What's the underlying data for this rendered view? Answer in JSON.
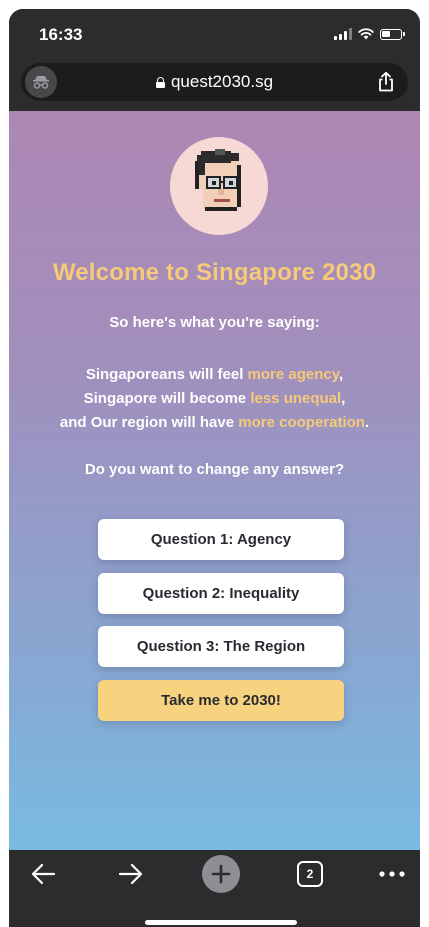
{
  "status_bar": {
    "time": "16:33",
    "battery_level": 0.45
  },
  "browser": {
    "url": "quest2030.sg",
    "incognito_icon": "incognito-icon",
    "share_icon": "share-icon",
    "open_tabs": "2"
  },
  "page": {
    "title": "Welcome to Singapore 2030",
    "intro": "So here's what you're saying:",
    "summary": {
      "line1_prefix": "Singaporeans will feel ",
      "line1_value": "more agency",
      "line1_suffix": ",",
      "line2_prefix": "Singapore will become ",
      "line2_value": "less unequal",
      "line2_suffix": ",",
      "line3_prefix": "and Our region will have ",
      "line3_value": "more cooperation",
      "line3_suffix": "."
    },
    "question": "Do you want to change any answer?",
    "buttons": {
      "q1": "Question 1: Agency",
      "q2": "Question 2: Inequality",
      "q3": "Question 3: The Region",
      "go": "Take me to 2030!"
    }
  },
  "colors": {
    "highlight": "#f6ca79",
    "primary_button": "#f7d27f",
    "gradient_top": "#ad87b3",
    "gradient_bottom": "#79bbe0"
  }
}
